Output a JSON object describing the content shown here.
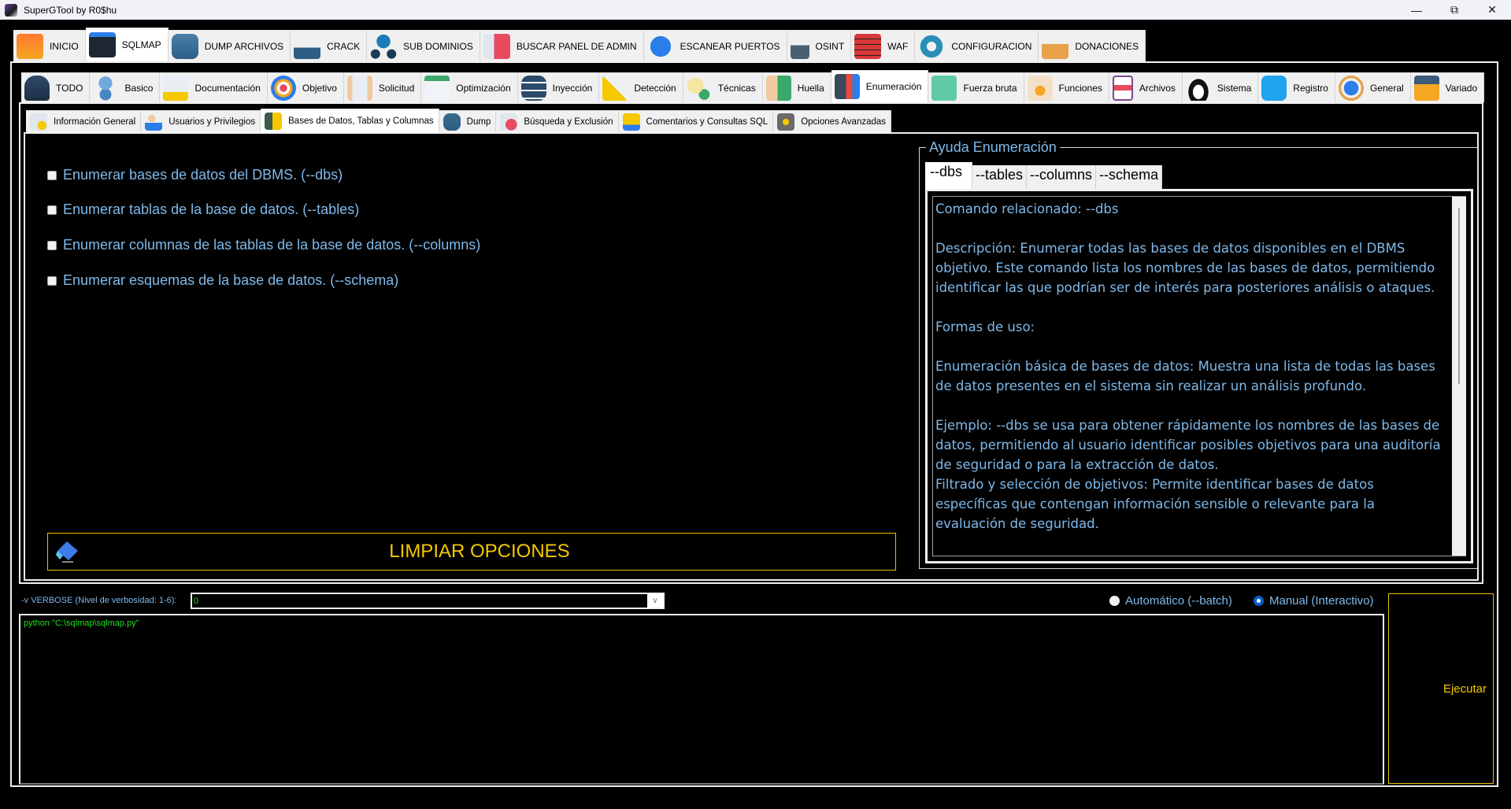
{
  "window": {
    "title": "SuperGTool by R0$hu",
    "controls": [
      "minimize",
      "maximize",
      "close"
    ]
  },
  "main_tabs": [
    {
      "label": "INICIO",
      "icon": "home-icon",
      "active": false
    },
    {
      "label": "SQLMAP",
      "icon": "terminal-icon",
      "active": true
    },
    {
      "label": "DUMP ARCHIVOS",
      "icon": "database-download-icon",
      "active": false
    },
    {
      "label": "CRACK",
      "icon": "password-crack-icon",
      "active": false
    },
    {
      "label": "SUB DOMINIOS",
      "icon": "network-globe-icon",
      "active": false
    },
    {
      "label": "BUSCAR PANEL DE ADMIN",
      "icon": "admin-panel-icon",
      "active": false
    },
    {
      "label": "ESCANEAR PUERTOS",
      "icon": "port-scan-icon",
      "active": false
    },
    {
      "label": "OSINT",
      "icon": "unlock-icon",
      "active": false
    },
    {
      "label": "WAF",
      "icon": "firewall-icon",
      "active": false
    },
    {
      "label": "CONFIGURACION",
      "icon": "gear-icon",
      "active": false
    },
    {
      "label": "DONACIONES",
      "icon": "donate-icon",
      "active": false
    }
  ],
  "sqlmap_tabs": [
    {
      "label": "TODO",
      "icon": "hacker-icon",
      "active": false
    },
    {
      "label": "Basico",
      "icon": "robot-icon",
      "active": false
    },
    {
      "label": "Documentación",
      "icon": "sql-document-icon",
      "active": false
    },
    {
      "label": "Objetivo",
      "icon": "target-icon",
      "active": false
    },
    {
      "label": "Solicitud",
      "icon": "request-form-icon",
      "active": false
    },
    {
      "label": "Optimización",
      "icon": "speedometer-icon",
      "active": false
    },
    {
      "label": "Inyección",
      "icon": "database-injection-icon",
      "active": false
    },
    {
      "label": "Detección",
      "icon": "warning-magnifier-icon",
      "active": false
    },
    {
      "label": "Técnicas",
      "icon": "idea-gear-icon",
      "active": false
    },
    {
      "label": "Huella",
      "icon": "fingerprint-icon",
      "active": false
    },
    {
      "label": "Enumeración",
      "icon": "server-person-icon",
      "active": true
    },
    {
      "label": "Fuerza bruta",
      "icon": "binary-chat-icon",
      "active": false
    },
    {
      "label": "Funciones",
      "icon": "head-gear-icon",
      "active": false
    },
    {
      "label": "Archivos",
      "icon": "root-file-icon",
      "active": false
    },
    {
      "label": "Sistema",
      "icon": "linux-penguin-icon",
      "active": false
    },
    {
      "label": "Registro",
      "icon": "windows-icon",
      "active": false
    },
    {
      "label": "General",
      "icon": "globe-cycle-icon",
      "active": false
    },
    {
      "label": "Variado",
      "icon": "toolbox-icon",
      "active": false
    }
  ],
  "enum_tabs": [
    {
      "label": "Información General",
      "icon": "info-search-icon",
      "active": false
    },
    {
      "label": "Usuarios y Privilegios",
      "icon": "user-privileges-icon",
      "active": false
    },
    {
      "label": "Bases de Datos, Tablas y Columnas",
      "icon": "database-table-icon",
      "active": true
    },
    {
      "label": "Dump",
      "icon": "database-dump-icon",
      "active": false
    },
    {
      "label": "Búsqueda y Exclusión",
      "icon": "search-exclude-icon",
      "active": false
    },
    {
      "label": "Comentarios y Consultas SQL",
      "icon": "sql-query-icon",
      "active": false
    },
    {
      "label": "Opciones Avanzadas",
      "icon": "chip-gear-icon",
      "active": false
    }
  ],
  "options": [
    {
      "label": "Enumerar bases de datos del DBMS. (--dbs)",
      "checked": false
    },
    {
      "label": "Enumerar tablas de la base de datos. (--tables)",
      "checked": false
    },
    {
      "label": "Enumerar columnas de las tablas de la base de datos. (--columns)",
      "checked": false
    },
    {
      "label": "Enumerar esquemas de la base de datos. (--schema)",
      "checked": false
    }
  ],
  "clear_button": {
    "label": "LIMPIAR OPCIONES",
    "icon": "eraser-icon"
  },
  "help": {
    "title": "Ayuda Enumeración",
    "tabs": [
      {
        "label": "--dbs",
        "active": true
      },
      {
        "label": "--tables",
        "active": false
      },
      {
        "label": "--columns",
        "active": false
      },
      {
        "label": "--schema",
        "active": false
      }
    ],
    "text": "Comando relacionado: --dbs\n\nDescripción: Enumerar todas las bases de datos disponibles en el DBMS objetivo. Este comando lista los nombres de las bases de datos, permitiendo identificar las que podrían ser de interés para posteriores análisis o ataques.\n\nFormas de uso:\n\nEnumeración básica de bases de datos: Muestra una lista de todas las bases de datos presentes en el sistema sin realizar un análisis profundo.\n\nEjemplo: --dbs se usa para obtener rápidamente los nombres de las bases de datos, permitiendo al usuario identificar posibles objetivos para una auditoría de seguridad o para la extracción de datos.\nFiltrado y selección de objetivos: Permite identificar bases de datos específicas que contengan información sensible o relevante para la evaluación de seguridad."
  },
  "verbose": {
    "label": "-v VERBOSE (Nivel de verbosidad: 1-6):",
    "value": "0"
  },
  "mode": {
    "options": [
      {
        "label": "Automático (--batch)",
        "checked": false
      },
      {
        "label": "Manual (Interactivo)",
        "checked": true
      }
    ]
  },
  "command": {
    "text": "python \"C:\\sqlmap\\sqlmap.py\""
  },
  "execute_button": {
    "label": "Ejecutar"
  },
  "colors": {
    "accent_yellow": "#f5c800",
    "text_blue": "#7fb9ea",
    "console_green": "#22dd22",
    "radio_selected": "#0a63c9"
  }
}
